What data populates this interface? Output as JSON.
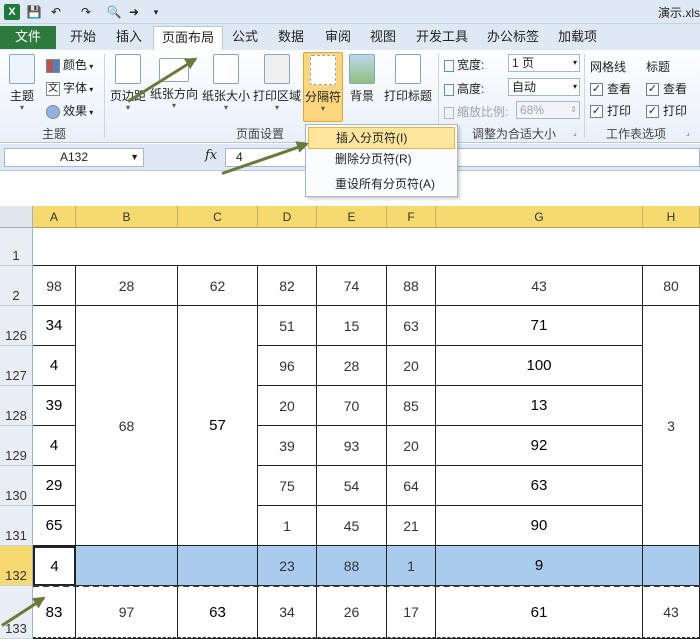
{
  "titlebar": {
    "title": "演示.xls"
  },
  "tabs": [
    {
      "label": "文件"
    },
    {
      "label": "开始"
    },
    {
      "label": "插入"
    },
    {
      "label": "页面布局"
    },
    {
      "label": "公式"
    },
    {
      "label": "数据"
    },
    {
      "label": "审阅"
    },
    {
      "label": "视图"
    },
    {
      "label": "开发工具"
    },
    {
      "label": "办公标签"
    },
    {
      "label": "加载项"
    }
  ],
  "ribbon": {
    "theme_group": {
      "label": "主题",
      "theme": "主题",
      "colors": "颜色",
      "fonts": "字体",
      "effects": "效果"
    },
    "page_setup_group": {
      "label": "页面设置",
      "margins": "页边距",
      "orientation": "纸张方向",
      "size": "纸张大小",
      "print_area": "打印区域",
      "breaks": "分隔符",
      "background": "背景",
      "print_titles": "打印标题"
    },
    "scale_group": {
      "label": "调整为合适大小",
      "width_label": "宽度:",
      "width_value": "1 页",
      "height_label": "高度:",
      "height_value": "自动",
      "scale_label": "缩放比例:",
      "scale_value": "68%"
    },
    "sheet_options_group": {
      "label": "工作表选项",
      "gridlines": "网格线",
      "headings": "标题",
      "view": "查看",
      "print": "打印"
    }
  },
  "breaks_menu": {
    "items": [
      {
        "label": "插入分页符(I)"
      },
      {
        "label": "删除分页符(R)"
      },
      {
        "label": "重设所有分页符(A)"
      }
    ]
  },
  "formula_bar": {
    "name_box": "A132",
    "fx": "fx",
    "value": "4"
  },
  "columns": [
    "A",
    "B",
    "C",
    "D",
    "E",
    "F",
    "G",
    "H"
  ],
  "rows": [
    "1",
    "2",
    "126",
    "127",
    "128",
    "129",
    "130",
    "131",
    "132",
    "133"
  ],
  "cells": {
    "r2": [
      "98",
      "28",
      "62",
      "82",
      "74",
      "88",
      "43",
      "80"
    ],
    "colA": [
      "34",
      "4",
      "39",
      "4",
      "29",
      "65"
    ],
    "colB_merged": "68",
    "colC_merged": "57",
    "colH_merged": "3",
    "colD": [
      "51",
      "96",
      "20",
      "39",
      "75",
      "1"
    ],
    "colE": [
      "15",
      "28",
      "70",
      "93",
      "54",
      "45"
    ],
    "colF": [
      "63",
      "20",
      "85",
      "20",
      "64",
      "21"
    ],
    "colG": [
      "71",
      "100",
      "13",
      "92",
      "63",
      "90"
    ],
    "r132": [
      "4",
      "",
      "",
      "23",
      "88",
      "1",
      "9",
      ""
    ],
    "r133": [
      "83",
      "97",
      "63",
      "34",
      "26",
      "17",
      "61",
      "43"
    ]
  },
  "colors": {
    "accent": "#2c7a3d",
    "selection": "#a9cbed",
    "header_highlight": "#f6d96f"
  }
}
